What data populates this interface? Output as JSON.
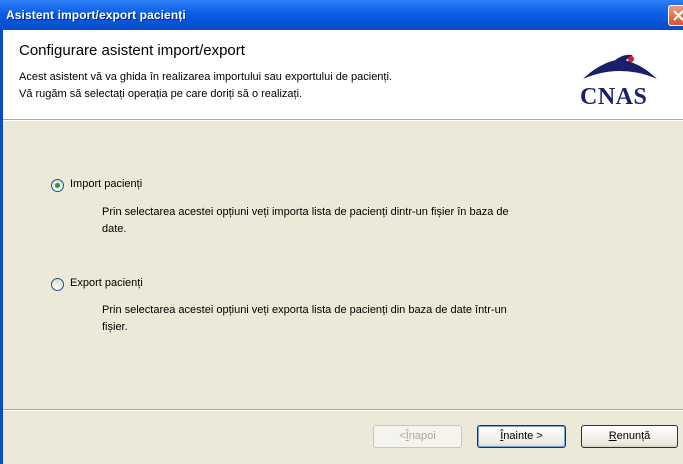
{
  "window": {
    "title": "Asistent import/export pacienți"
  },
  "header": {
    "title": "Configurare asistent import/export",
    "description_line1": "Acest asistent vă va ghida în realizarea importului sau exportului de pacienți.",
    "description_line2": "Vă rugăm să selectați operația pe care doriți să o realizați.",
    "logo_text": "CNAS"
  },
  "options": [
    {
      "label": "Import pacienți",
      "checked": true,
      "description_line1": "Prin selectarea acestei opțiuni veți importa lista de pacienți dintr-un fișier în baza de",
      "description_line2": "date."
    },
    {
      "label": "Export pacienți",
      "checked": false,
      "description_line1": "Prin selectarea acestei opțiuni veți exporta lista de pacienți din baza de date într-un",
      "description_line2": "fișier."
    }
  ],
  "buttons": {
    "back": {
      "pre": "",
      "accel": "Î",
      "post": "napoi",
      "arrow": "<",
      "enabled": false
    },
    "next": {
      "pre": "",
      "accel": "Î",
      "post": "nainte",
      "arrow": ">",
      "enabled": true
    },
    "cancel": {
      "pre": "",
      "accel": "R",
      "post": "enunță",
      "enabled": true
    }
  },
  "colors": {
    "titlebar": "#0a5ee6",
    "dialog_background": "#ece9d8",
    "radio_dot": "#21a121",
    "logo_text": "#1a1f6b"
  },
  "icons": {
    "close": "close-icon",
    "logo": "cnas-logo-icon"
  }
}
